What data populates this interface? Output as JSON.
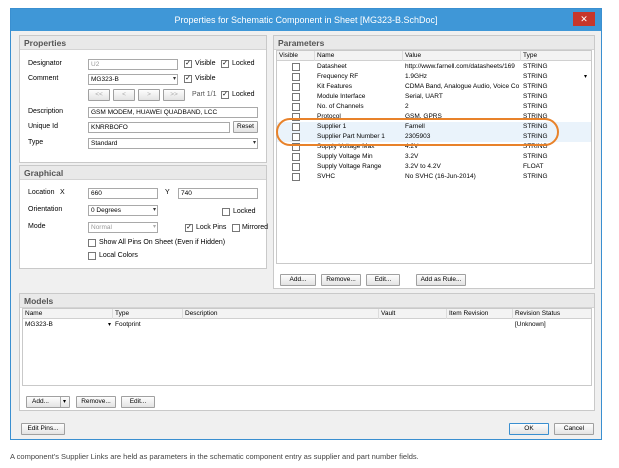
{
  "window": {
    "title": "Properties for Schematic Component in Sheet [MG323-B.SchDoc]",
    "close_glyph": "✕"
  },
  "properties": {
    "title": "Properties",
    "designator_label": "Designator",
    "designator_value": "U2",
    "visible_label": "Visible",
    "locked_label": "Locked",
    "comment_label": "Comment",
    "comment_value": "MG323-B",
    "comment_visible_label": "Visible",
    "nav_buttons": [
      "<<",
      "<",
      ">",
      ">>"
    ],
    "part_label": "Part 1/1",
    "part_locked_label": "Locked",
    "description_label": "Description",
    "description_value": "GSM MODEM, HUAWEI QUADBAND, LCC",
    "unique_id_label": "Unique Id",
    "unique_id_value": "KNRRBOFO",
    "reset_label": "Reset",
    "type_label": "Type",
    "type_value": "Standard"
  },
  "graphical": {
    "title": "Graphical",
    "location_label": "Location",
    "x_label": "X",
    "x_value": "660",
    "y_label": "Y",
    "y_value": "740",
    "orientation_label": "Orientation",
    "orientation_value": "0 Degrees",
    "locked_label": "Locked",
    "mode_label": "Mode",
    "mode_value": "Normal",
    "lock_pins_label": "Lock Pins",
    "mirrored_label": "Mirrored",
    "show_all_pins_label": "Show All Pins On Sheet (Even if Hidden)",
    "local_colors_label": "Local Colors"
  },
  "parameters": {
    "title": "Parameters",
    "columns": [
      "Visible",
      "Name",
      "Value",
      "Type"
    ],
    "rows": [
      {
        "name": "Datasheet",
        "value": "http://www.farnell.com/datasheets/169",
        "type": "STRING"
      },
      {
        "name": "Frequency RF",
        "value": "1.9GHz",
        "type": "STRING"
      },
      {
        "name": "Kit Features",
        "value": "CDMA Band, Analogue Audio, Voice Co",
        "type": "STRING"
      },
      {
        "name": "Module Interface",
        "value": "Serial, UART",
        "type": "STRING"
      },
      {
        "name": "No. of Channels",
        "value": "2",
        "type": "STRING"
      },
      {
        "name": "Protocol",
        "value": "GSM, GPRS",
        "type": "STRING"
      },
      {
        "name": "Supplier 1",
        "value": "Farnell",
        "type": "STRING"
      },
      {
        "name": "Supplier Part Number 1",
        "value": "2305903",
        "type": "STRING"
      },
      {
        "name": "Supply Voltage Max",
        "value": "4.2V",
        "type": "STRING"
      },
      {
        "name": "Supply Voltage Min",
        "value": "3.2V",
        "type": "STRING"
      },
      {
        "name": "Supply Voltage Range",
        "value": "3.2V to 4.2V",
        "type": "FLOAT"
      },
      {
        "name": "SVHC",
        "value": "No SVHC (16-Jun-2014)",
        "type": "STRING"
      }
    ],
    "add_label": "Add...",
    "remove_label": "Remove...",
    "edit_label": "Edit...",
    "add_as_rule_label": "Add as Rule..."
  },
  "models": {
    "title": "Models",
    "columns": [
      "Name",
      "Type",
      "Description",
      "Vault",
      "Item Revision",
      "Revision Status"
    ],
    "rows": [
      {
        "name": "MG323-B",
        "type": "Footprint",
        "description": "",
        "vault": "",
        "item_revision": "",
        "revision_status": "[Unknown]"
      }
    ],
    "add_label": "Add...",
    "remove_label": "Remove...",
    "edit_label": "Edit..."
  },
  "footer": {
    "edit_pins_label": "Edit Pins...",
    "ok_label": "OK",
    "cancel_label": "Cancel"
  },
  "caption": "A component's Supplier Links are held as parameters in the schematic component entry as supplier and part number fields.",
  "colors": {
    "titlebar": "#3f97d7",
    "highlight": "#e8822a",
    "close": "#c7362b"
  }
}
